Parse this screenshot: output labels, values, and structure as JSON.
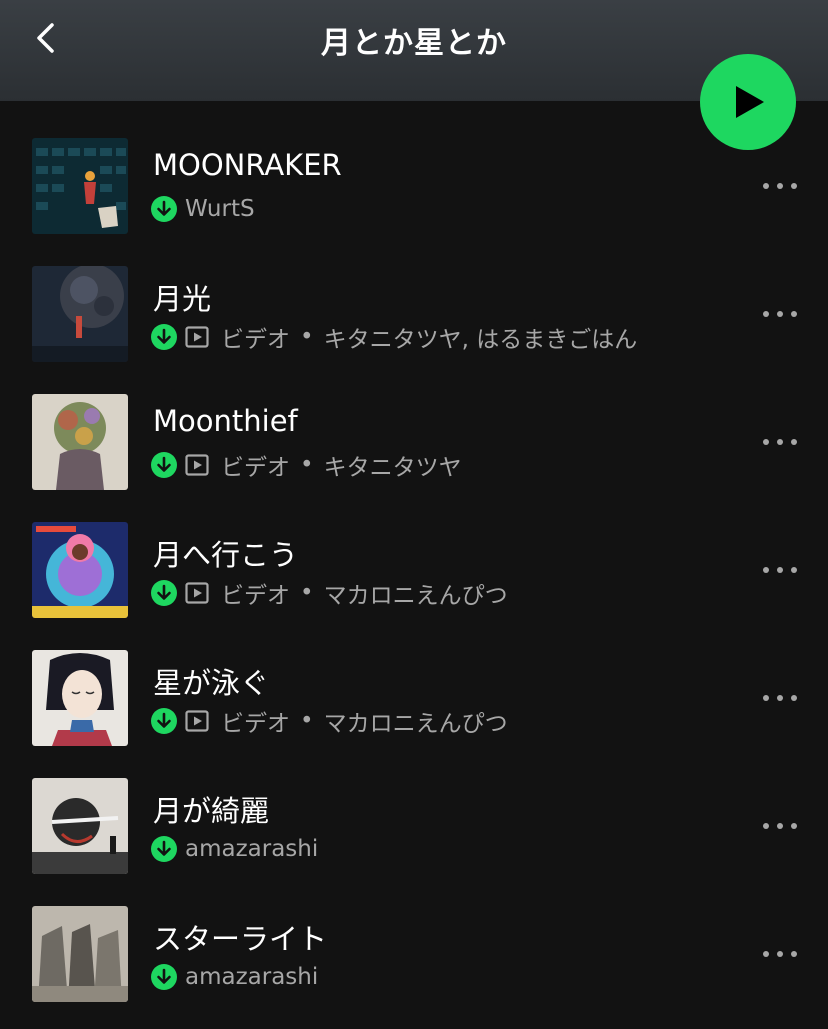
{
  "header": {
    "title": "月とか星とか",
    "back_icon": "chevron-left-icon",
    "play_icon": "play-icon",
    "accent": "#1ed760"
  },
  "tracks": [
    {
      "title": "MOONRAKER",
      "video": false,
      "video_label": "",
      "separator": "",
      "artist": "WurtS"
    },
    {
      "title": "月光",
      "video": true,
      "video_label": "ビデオ",
      "separator": "•",
      "artist": "キタニタツヤ, はるまきごはん"
    },
    {
      "title": "Moonthief",
      "video": true,
      "video_label": "ビデオ",
      "separator": "•",
      "artist": "キタニタツヤ"
    },
    {
      "title": "月へ行こう",
      "video": true,
      "video_label": "ビデオ",
      "separator": "•",
      "artist": "マカロニえんぴつ"
    },
    {
      "title": "星が泳ぐ",
      "video": true,
      "video_label": "ビデオ",
      "separator": "•",
      "artist": "マカロニえんぴつ"
    },
    {
      "title": "月が綺麗",
      "video": false,
      "video_label": "",
      "separator": "",
      "artist": "amazarashi"
    },
    {
      "title": "スターライト",
      "video": false,
      "video_label": "",
      "separator": "",
      "artist": "amazarashi"
    }
  ]
}
